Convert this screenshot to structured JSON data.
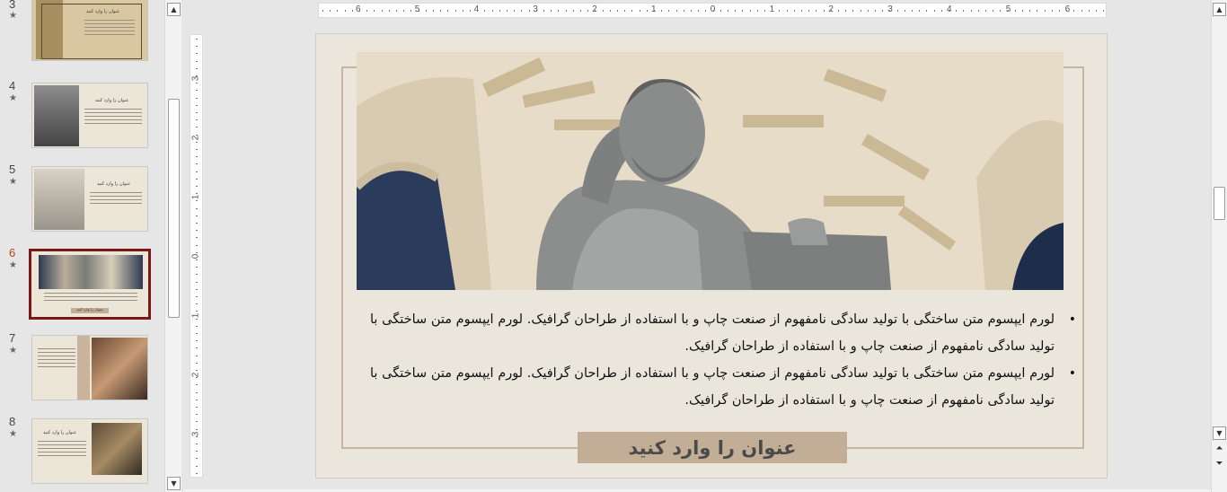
{
  "thumbnails": [
    {
      "number": "3",
      "title": "عنوان را وارد کنید"
    },
    {
      "number": "4",
      "title": "عنوان را وارد کنید"
    },
    {
      "number": "5",
      "title": "عنوان را وارد کنید"
    },
    {
      "number": "6",
      "title": "عنوان را وارد کنید"
    },
    {
      "number": "7",
      "title": ""
    },
    {
      "number": "8",
      "title": "عنوان را وارد کنید"
    }
  ],
  "thumbnail_star": "★",
  "active_slide": "6",
  "ruler": {
    "horizontal": [
      "6",
      "5",
      "4",
      "3",
      "2",
      "1",
      "0",
      "1",
      "2",
      "3",
      "4",
      "5",
      "6"
    ],
    "vertical": [
      "3",
      "2",
      "1",
      "0",
      "1",
      "2",
      "3"
    ]
  },
  "slide": {
    "bullets": [
      "لورم ایپسوم متن ساختگی با تولید سادگی نامفهوم از صنعت چاپ و با استفاده از طراحان گرافیک. لورم ایپسوم متن ساختگی با تولید سادگی نامفهوم از صنعت چاپ و با استفاده از طراحان گرافیک.",
      "لورم ایپسوم متن ساختگی با تولید سادگی نامفهوم از صنعت چاپ و با استفاده از طراحان گرافیک. لورم ایپسوم متن ساختگی با تولید سادگی نامفهوم از صنعت چاپ و با استفاده از طراحان گرافیک."
    ],
    "bullet_symbol": "•",
    "title": "عنوان را وارد کنید"
  },
  "scrollbar": {
    "up_arrow": "▲",
    "down_arrow": "▼",
    "prev_slide": "⏶",
    "next_slide": "⏷"
  },
  "colors": {
    "active_thumb_border": "#7a1717",
    "slide_bg": "#ebe6dc",
    "title_box": "#c2ad97",
    "frame": "#c8b4a0"
  }
}
